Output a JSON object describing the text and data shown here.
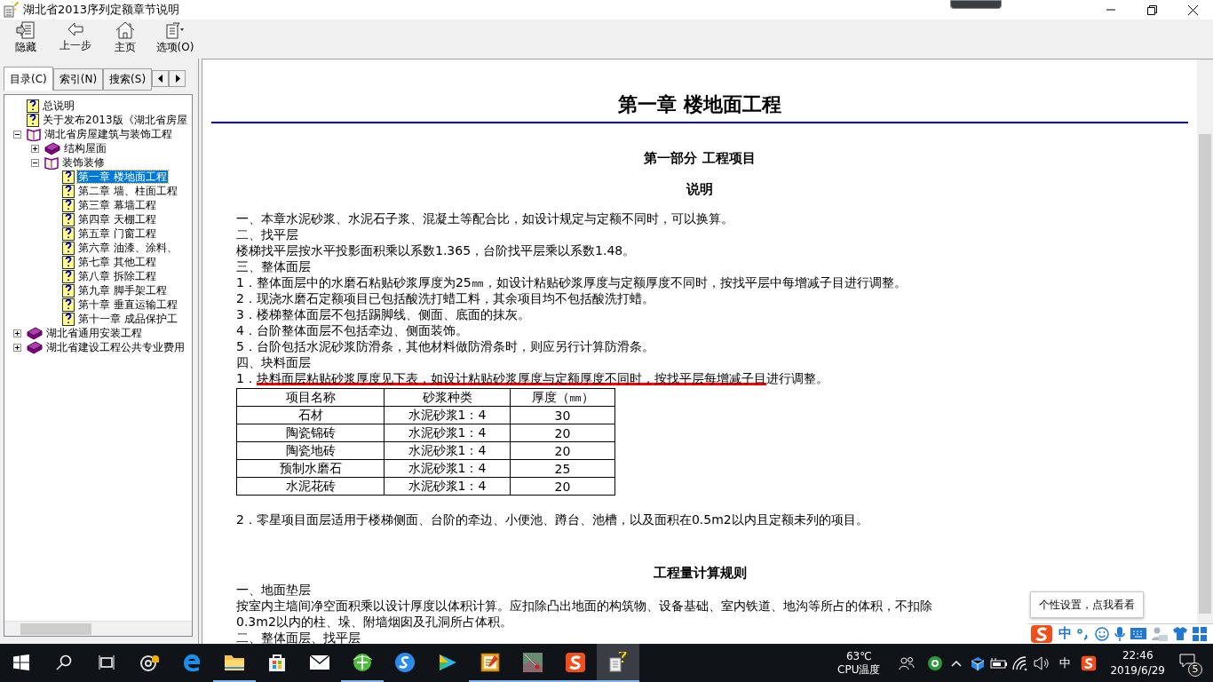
{
  "window": {
    "title": "湖北省2013序列定额章节说明"
  },
  "toolbar": [
    {
      "label": "隐藏",
      "kind": "hide"
    },
    {
      "label": "上一步",
      "kind": "back"
    },
    {
      "label": "主页",
      "kind": "home"
    },
    {
      "label": "选项(O)",
      "kind": "options"
    }
  ],
  "nav_tabs": [
    {
      "label": "目录(C)",
      "selected": true
    },
    {
      "label": "索引(N)",
      "selected": false
    },
    {
      "label": "搜索(S)",
      "selected": false
    }
  ],
  "tree": [
    {
      "label": "总说明",
      "kind": "page",
      "selected": false
    },
    {
      "label": "关于发布2013版《湖北省房屋",
      "kind": "page",
      "selected": false
    },
    {
      "label": "湖北省房屋建筑与装饰工程",
      "kind": "book",
      "expanded": true,
      "children": [
        {
          "label": "结构屋面",
          "kind": "book",
          "expanded": false
        },
        {
          "label": "装饰装修",
          "kind": "book",
          "expanded": true,
          "children": [
            {
              "label": "第一章  楼地面工程",
              "kind": "page",
              "selected": true
            },
            {
              "label": "第二章  墙、柱面工程",
              "kind": "page",
              "selected": false
            },
            {
              "label": "第三章  幕墙工程",
              "kind": "page",
              "selected": false
            },
            {
              "label": "第四章  天棚工程",
              "kind": "page",
              "selected": false
            },
            {
              "label": "第五章  门窗工程",
              "kind": "page",
              "selected": false
            },
            {
              "label": "第六章  油漆、涂料、",
              "kind": "page",
              "selected": false
            },
            {
              "label": "第七章  其他工程",
              "kind": "page",
              "selected": false
            },
            {
              "label": "第八章  拆除工程",
              "kind": "page",
              "selected": false
            },
            {
              "label": "第九章  脚手架工程",
              "kind": "page",
              "selected": false
            },
            {
              "label": "第十章  垂直运输工程",
              "kind": "page",
              "selected": false
            },
            {
              "label": "第十一章  成品保护工",
              "kind": "page",
              "selected": false
            }
          ]
        }
      ]
    },
    {
      "label": "湖北省通用安装工程",
      "kind": "book",
      "expanded": false
    },
    {
      "label": "湖北省建设工程公共专业费用",
      "kind": "book",
      "expanded": false
    }
  ],
  "document": {
    "title": "第一章  楼地面工程",
    "part": "第一部分  工程项目",
    "heading": "说明",
    "lines": [
      {
        "kind": "line",
        "text": "一、本章水泥砂浆、水泥石子浆、混凝土等配合比，如设计规定与定额不同时，可以换算。"
      },
      {
        "kind": "line",
        "text": "二、找平层"
      },
      {
        "kind": "line",
        "text": "楼梯找平层按水平投影面积乘以系数1.365，台阶找平层乘以系数1.48。"
      },
      {
        "kind": "line",
        "text": "三、整体面层"
      },
      {
        "kind": "line",
        "text": "1．整体面层中的水磨石粘贴砂浆厚度为25㎜，如设计粘贴砂浆厚度与定额厚度不同时，按找平层中每增减子目进行调整。"
      },
      {
        "kind": "line",
        "text": "2．现浇水磨石定额项目已包括酸洗打蜡工料，其余项目均不包括酸洗打蜡。"
      },
      {
        "kind": "line",
        "text": "3．楼梯整体面层不包括踢脚线、侧面、底面的抹灰。"
      },
      {
        "kind": "line",
        "text": "4．台阶整体面层不包括牵边、侧面装饰。"
      },
      {
        "kind": "line",
        "text": "5．台阶包括水泥砂浆防滑条，其他材料做防滑条时，则应另行计算防滑条。"
      },
      {
        "kind": "line",
        "text": "四、块料面层"
      },
      {
        "kind": "marked",
        "lead": "1．",
        "marked": "块料面层粘贴砂浆厚度见下表，如设计粘贴砂浆厚度与定额厚度不同时，按找平层每增减子目",
        "tail": "进行调整。"
      }
    ],
    "table": {
      "columns": [
        "项目名称",
        "砂浆种类",
        "厚度（㎜）"
      ],
      "rows": [
        [
          "石材",
          "水泥砂浆1：4",
          "30"
        ],
        [
          "陶瓷锦砖",
          "水泥砂浆1：4",
          "20"
        ],
        [
          "陶瓷地砖",
          "水泥砂浆1：4",
          "20"
        ],
        [
          "预制水磨石",
          "水泥砂浆1：4",
          "25"
        ],
        [
          "水泥花砖",
          "水泥砂浆1：4",
          "20"
        ]
      ]
    },
    "note": "2．零星项目面层适用于楼梯侧面、台阶的牵边、小便池、蹲台、池槽，以及面积在0.5m2以内且定额未列的项目。",
    "rules_heading": "工程量计算规则",
    "rules": [
      "一、地面垫层",
      "按室内主墙间净空面积乘以设计厚度以体积计算。应扣除凸出地面的构筑物、设备基础、室内铁道、地沟等所占的体积，不扣除",
      "0.3m2以内的柱、垛、附墙烟囱及孔洞所占体积。",
      "二、整体面层、找平层"
    ]
  },
  "tooltip": "个性设置，点我看看",
  "ime": {
    "mode": "中"
  },
  "taskbar": {
    "apps": [
      {
        "kind": "cortana",
        "running": false,
        "active": false
      },
      {
        "kind": "edge",
        "running": false,
        "active": false
      },
      {
        "kind": "folder",
        "running": true,
        "active": false
      },
      {
        "kind": "store",
        "running": false,
        "active": false
      },
      {
        "kind": "mail",
        "running": false,
        "active": false
      },
      {
        "kind": "globe",
        "running": true,
        "active": false
      },
      {
        "kind": "swirl",
        "running": false,
        "active": false
      },
      {
        "kind": "play",
        "running": false,
        "active": false
      },
      {
        "kind": "notes",
        "running": true,
        "active": false
      },
      {
        "kind": "map",
        "running": true,
        "active": false
      },
      {
        "kind": "sogou",
        "running": true,
        "active": false
      },
      {
        "kind": "help",
        "running": true,
        "active": true
      }
    ],
    "temperature": "63℃",
    "temperature_label": "CPU温度",
    "input_mode": "中",
    "time": "22:46",
    "date": "2019/6/29",
    "notifications": "5"
  }
}
